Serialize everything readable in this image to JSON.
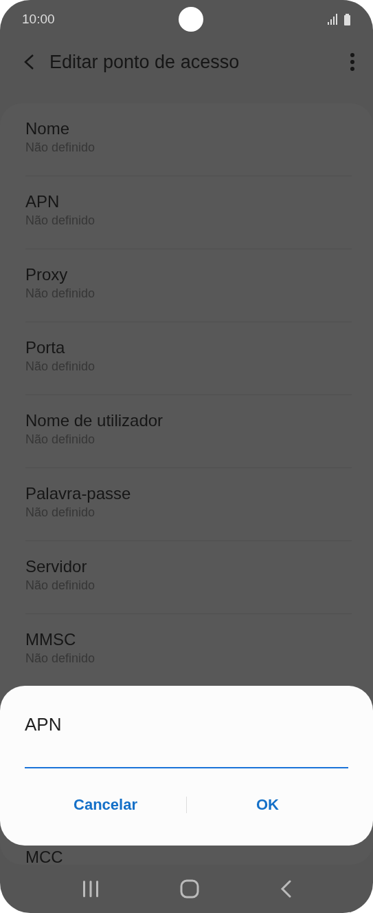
{
  "status_bar": {
    "time": "10:00"
  },
  "app_bar": {
    "title": "Editar ponto de acesso"
  },
  "settings": [
    {
      "title": "Nome",
      "value": "Não definido"
    },
    {
      "title": "APN",
      "value": "Não definido"
    },
    {
      "title": "Proxy",
      "value": "Não definido"
    },
    {
      "title": "Porta",
      "value": "Não definido"
    },
    {
      "title": "Nome de utilizador",
      "value": "Não definido"
    },
    {
      "title": "Palavra-passe",
      "value": "Não definido"
    },
    {
      "title": "Servidor",
      "value": "Não definido"
    },
    {
      "title": "MMSC",
      "value": "Não definido"
    }
  ],
  "partial_setting": {
    "title": "MCC"
  },
  "dialog": {
    "title": "APN",
    "buttons": [
      "Cancelar",
      "OK"
    ]
  }
}
